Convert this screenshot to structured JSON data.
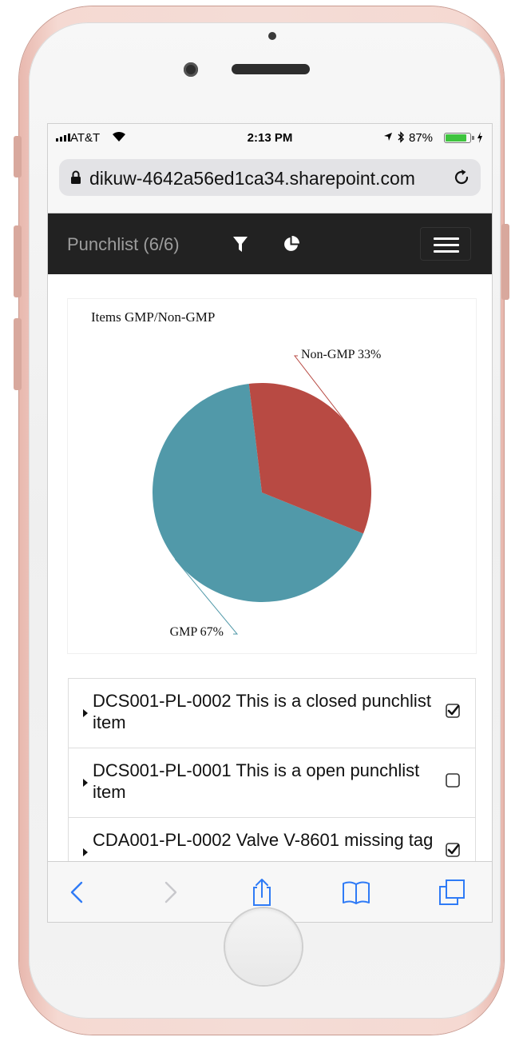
{
  "status_bar": {
    "carrier": "AT&T",
    "time": "2:13 PM",
    "battery_percent": "87%",
    "battery_level": 0.87
  },
  "browser": {
    "url": "dikuw-4642a56ed1ca34.sharepoint.com"
  },
  "navbar": {
    "brand": "Punchlist (6/6)",
    "icons": [
      "filter-icon",
      "pie-chart-icon",
      "hamburger-menu-icon"
    ]
  },
  "chart_data": {
    "type": "pie",
    "title": "Items GMP/Non-GMP",
    "slices": [
      {
        "label": "GMP 67%",
        "value": 67,
        "color": "#5199a9"
      },
      {
        "label": "Non-GMP 33%",
        "value": 33,
        "color": "#b84a43"
      }
    ]
  },
  "punchlist": {
    "items": [
      {
        "text": "DCS001-PL-0002 This is a closed punchlist item",
        "checked": true
      },
      {
        "text": "DCS001-PL-0001 This is a open punchlist item",
        "checked": false
      },
      {
        "text": "CDA001-PL-0002 Valve V-8601 missing tag",
        "checked": true
      }
    ]
  },
  "toolbar": {
    "icons": [
      "back-icon",
      "forward-icon",
      "share-icon",
      "bookmarks-icon",
      "tabs-icon"
    ]
  },
  "colors": {
    "navbar_bg": "#222222",
    "brand_text": "#9d9d9d",
    "ios_blue": "#2f7bf6",
    "phone_rose_gold": "#f4dcd6"
  }
}
